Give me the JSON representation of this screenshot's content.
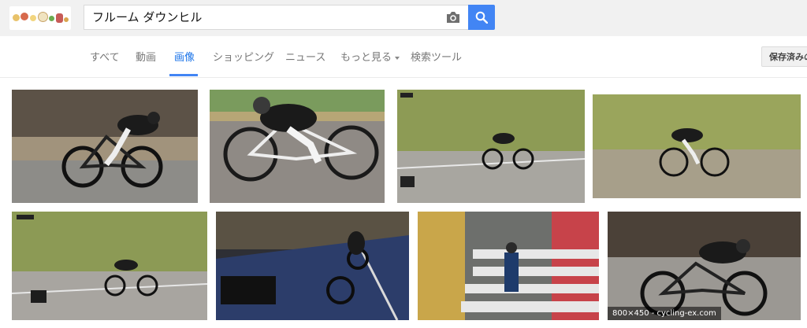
{
  "search": {
    "query": "フルーム ダウンヒル",
    "camera_icon": "camera-icon",
    "search_icon": "magnifier-icon"
  },
  "tabs": [
    {
      "label": "すべて",
      "active": false
    },
    {
      "label": "動画",
      "active": false
    },
    {
      "label": "画像",
      "active": true
    },
    {
      "label": "ショッピング",
      "active": false
    },
    {
      "label": "ニュース",
      "active": false
    },
    {
      "label": "もっと見る",
      "active": false,
      "dropdown": true
    },
    {
      "label": "検索ツール",
      "active": false
    }
  ],
  "saved_button": {
    "label": "保存済みの"
  },
  "results": [
    {
      "caption": ""
    },
    {
      "caption": ""
    },
    {
      "caption": ""
    },
    {
      "caption": ""
    },
    {
      "caption": ""
    },
    {
      "caption": ""
    },
    {
      "caption": ""
    },
    {
      "caption": "800×450 - cycling-ex.com"
    }
  ],
  "colors": {
    "accent": "#4285f4",
    "active_tab": "#1a73e8",
    "header_bg": "#f1f1f1"
  }
}
